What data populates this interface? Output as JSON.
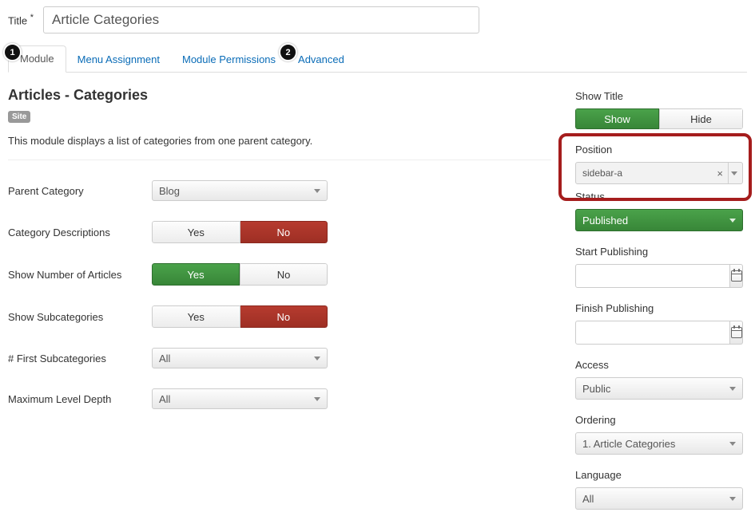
{
  "title_label": "Title",
  "title_required": "*",
  "title_value": "Article Categories",
  "tabs": [
    "Module",
    "Menu Assignment",
    "Module Permissions",
    "Advanced"
  ],
  "callouts": {
    "c1": "1",
    "c2": "2"
  },
  "module": {
    "heading": "Articles - Categories",
    "badge": "Site",
    "description": "This module displays a list of categories from one parent category."
  },
  "opts": {
    "yes": "Yes",
    "no": "No"
  },
  "left_fields": {
    "parent_category": {
      "label": "Parent Category",
      "value": "Blog"
    },
    "category_descriptions": {
      "label": "Category Descriptions",
      "selected": "no"
    },
    "show_number": {
      "label": "Show Number of Articles",
      "selected": "yes"
    },
    "show_subcats": {
      "label": "Show Subcategories",
      "selected": "no"
    },
    "first_subcats": {
      "label": "# First Subcategories",
      "value": "All"
    },
    "max_level": {
      "label": "Maximum Level Depth",
      "value": "All"
    }
  },
  "right": {
    "show_title": {
      "label": "Show Title",
      "show": "Show",
      "hide": "Hide",
      "selected": "show"
    },
    "position": {
      "label": "Position",
      "value": "sidebar-a"
    },
    "status": {
      "label": "Status",
      "value": "Published"
    },
    "start_pub": {
      "label": "Start Publishing",
      "value": ""
    },
    "finish_pub": {
      "label": "Finish Publishing",
      "value": ""
    },
    "access": {
      "label": "Access",
      "value": "Public"
    },
    "ordering": {
      "label": "Ordering",
      "value": "1. Article Categories"
    },
    "language": {
      "label": "Language",
      "value": "All"
    }
  }
}
